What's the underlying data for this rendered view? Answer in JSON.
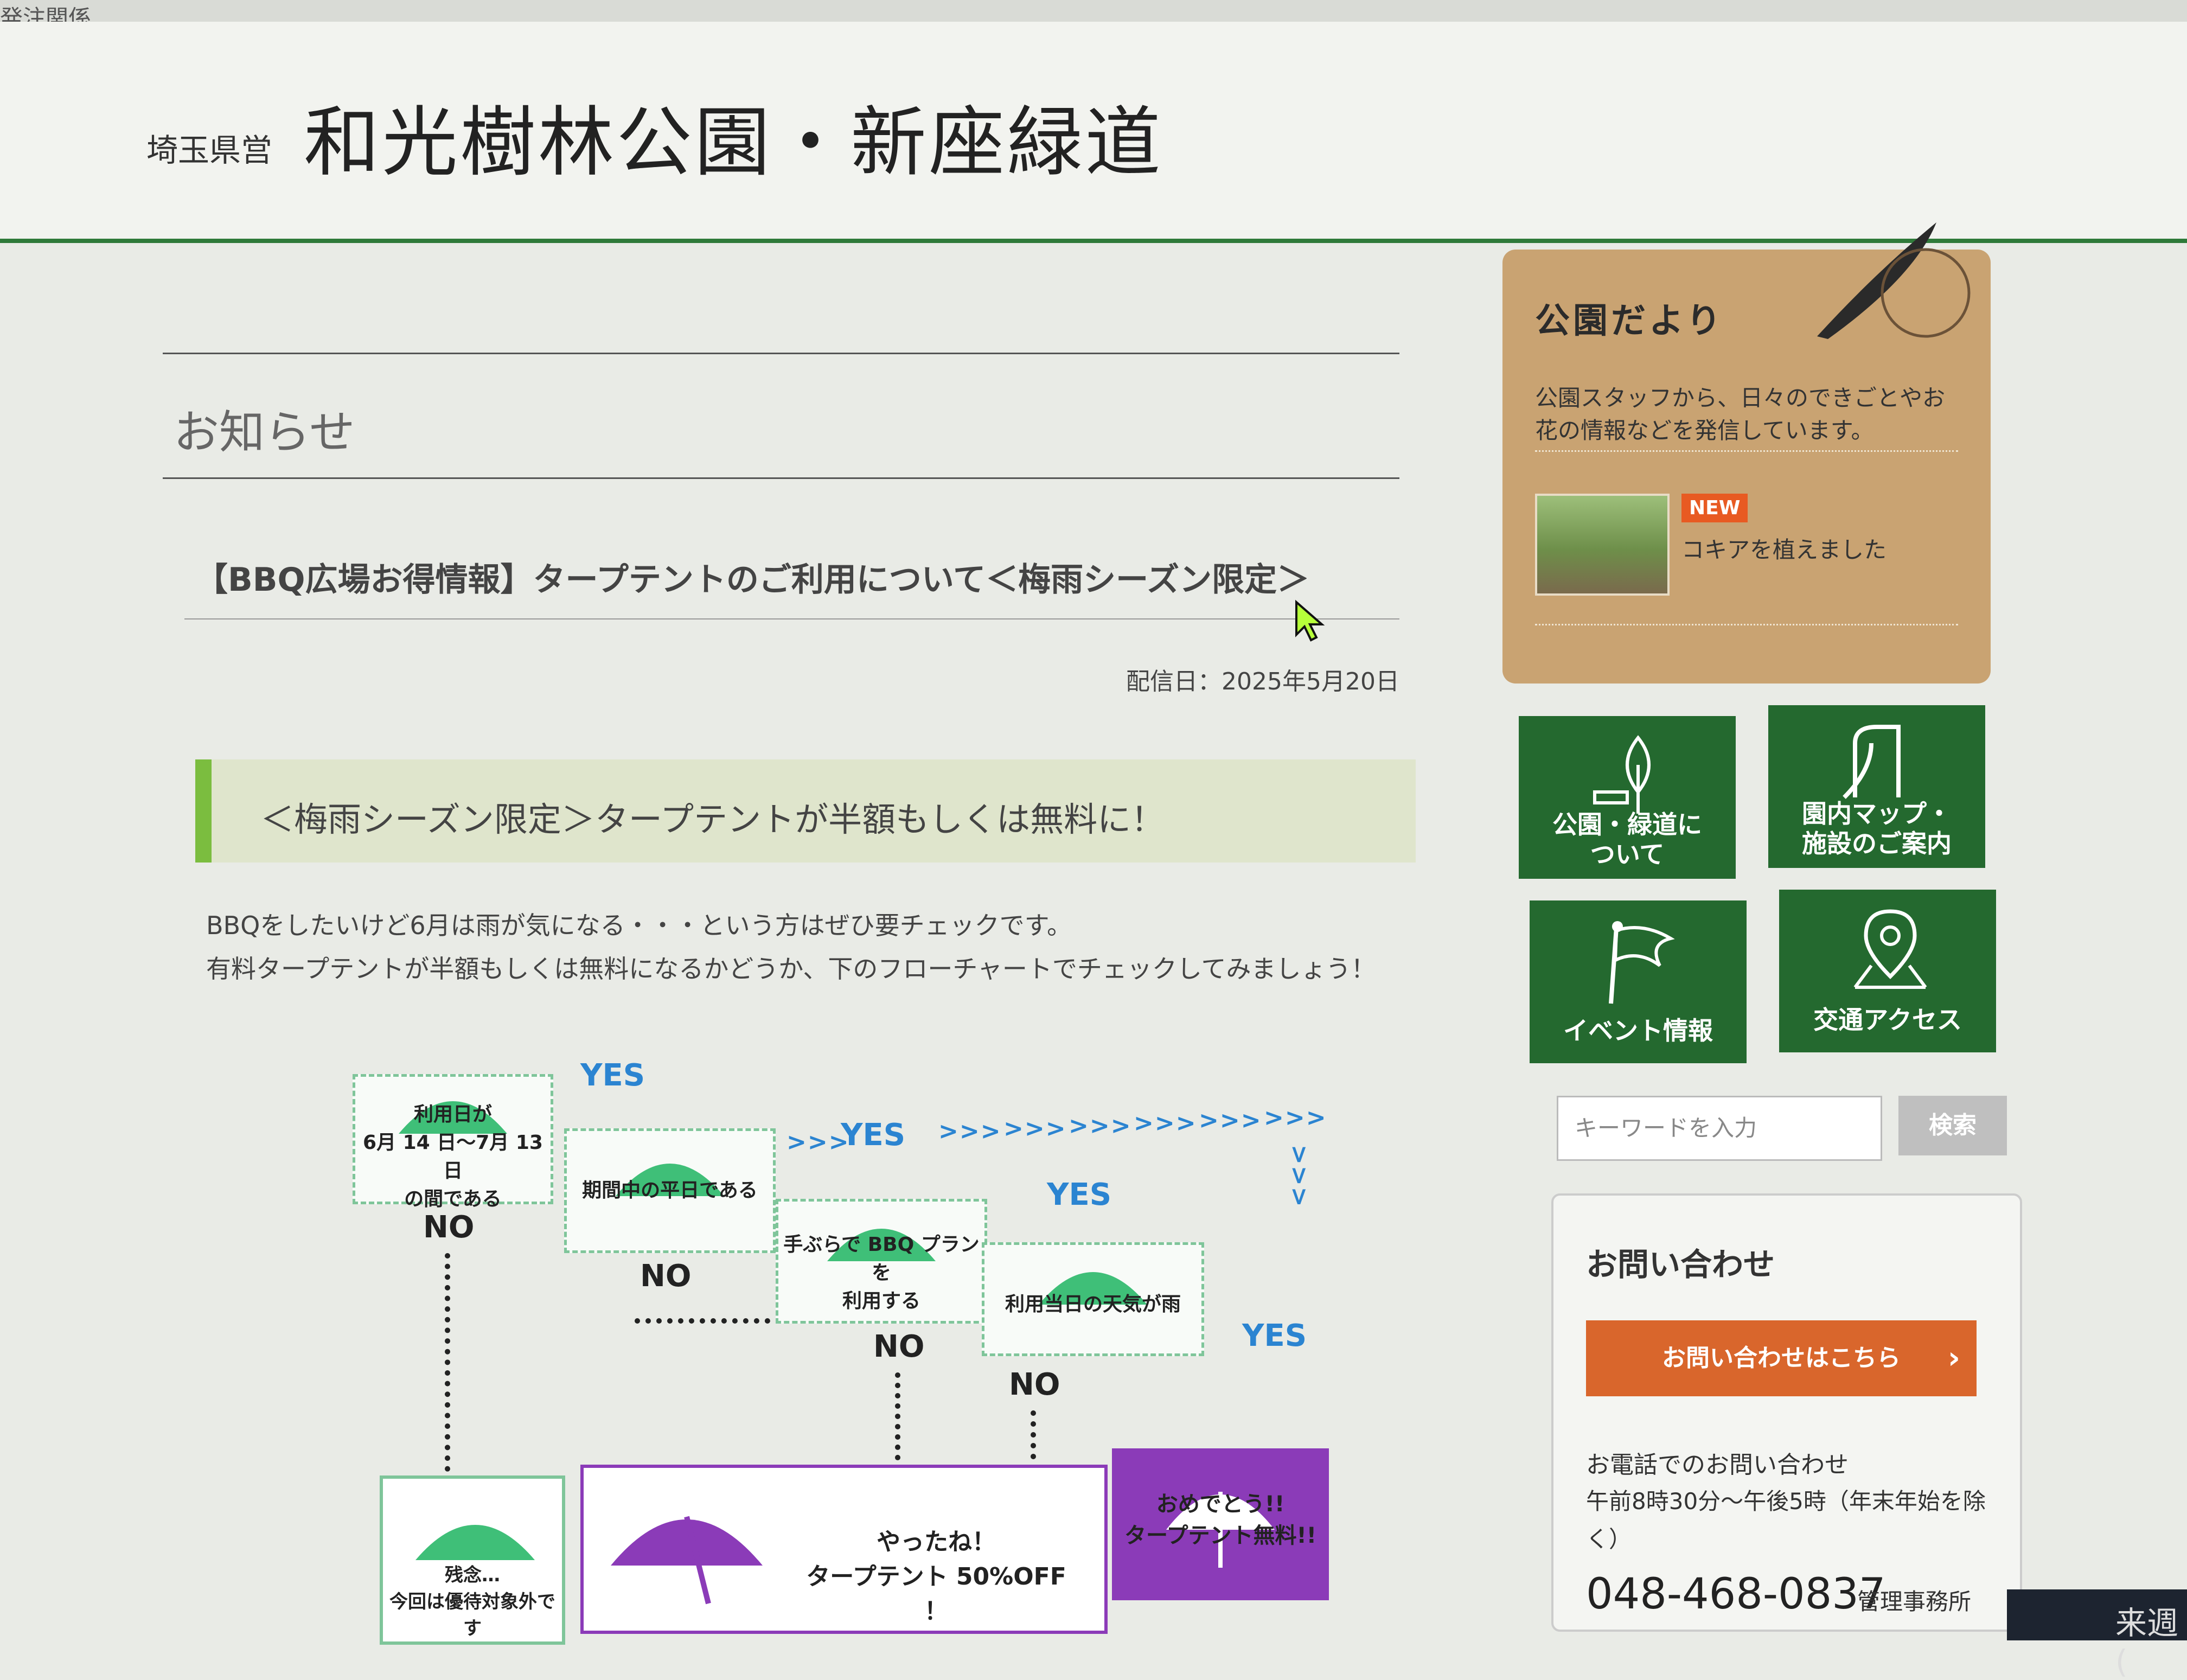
{
  "topbar": {
    "text": "発注関係"
  },
  "header": {
    "pref_label": "埼玉県営",
    "site_title": "和光樹林公園・新座緑道"
  },
  "main": {
    "section_heading": "お知らせ",
    "article_title": "【BBQ広場お得情報】タープテントのご利用について＜梅雨シーズン限定＞",
    "date": "配信日：2025年5月20日",
    "subheading": "＜梅雨シーズン限定＞タープテントが半額もしくは無料に！",
    "body_lines": [
      "BBQをしたいけど6月は雨が気になる・・・という方はぜひ要チェックです。",
      "有料タープテントが半額もしくは無料になるかどうか、下のフローチャートでチェックしてみましょう！"
    ]
  },
  "flowchart": {
    "q1": "利用日が\n6月 14 日〜7月 13 日\nの間である",
    "q2": "期間中の平日である",
    "q3": "手ぶらで BBQ プランを\n利用する",
    "q4": "利用当日の天気が雨",
    "yes": "YES",
    "no": "NO",
    "chevrons": ">>> ",
    "result_none": "残念…\n今回は優待対象外です",
    "result_half": "やったね！\nタープテント 50%OFF ！",
    "result_free": "おめでとう!!\nタープテント無料!!",
    "colors": {
      "green": "#3fbf78",
      "purple": "#8b3bb8",
      "blue": "#2b84d1"
    }
  },
  "sidebar": {
    "blog": {
      "title": "公園だより",
      "desc_1": "公園スタッフから、日々のできごとやお",
      "desc_2": "花の情報などを発信しています。",
      "badge": "NEW",
      "post_title": "コキアを植えました",
      "stamp_icon": "postal-stamp-icon"
    },
    "tiles": [
      {
        "label_1": "公園・緑道に",
        "label_2": "ついて",
        "icon": "tree-bench-icon"
      },
      {
        "label_1": "園内マップ・",
        "label_2": "施設のご案内",
        "icon": "slide-icon"
      },
      {
        "label_1": "イベント情報",
        "label_2": "",
        "icon": "flag-icon"
      },
      {
        "label_1": "交通アクセス",
        "label_2": "",
        "icon": "map-pin-icon"
      }
    ],
    "search": {
      "placeholder": "キーワードを入力",
      "button": "検索"
    },
    "contact": {
      "title": "お問い合わせ",
      "button": "お問い合わせはこちら",
      "button_arrow": "›",
      "phone_title": "お電話でのお問い合わせ",
      "hours_1": "午前8時30分〜午後5時（年末年始を除",
      "hours_2": "く）",
      "phone": "048-468-0837",
      "office": "管理事務所"
    }
  },
  "taskbar": {
    "text": "来週("
  }
}
